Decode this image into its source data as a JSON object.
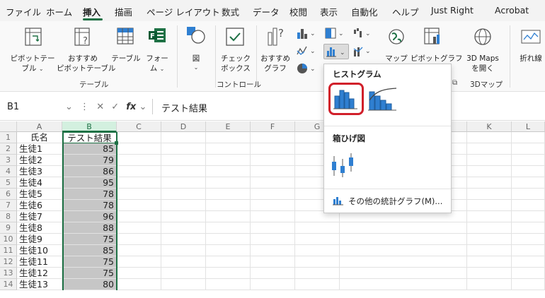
{
  "tabs": [
    {
      "label": "ファイル",
      "active": false
    },
    {
      "label": "ホーム",
      "active": false
    },
    {
      "label": "挿入",
      "active": true
    },
    {
      "label": "描画",
      "active": false
    },
    {
      "label": "ページ レイアウト",
      "active": false
    },
    {
      "label": "数式",
      "active": false
    },
    {
      "label": "データ",
      "active": false
    },
    {
      "label": "校閲",
      "active": false
    },
    {
      "label": "表示",
      "active": false
    },
    {
      "label": "自動化",
      "active": false
    },
    {
      "label": "ヘルプ",
      "active": false
    },
    {
      "label": "Just Right",
      "active": false
    },
    {
      "label": "Acrobat",
      "active": false
    }
  ],
  "ribbon": {
    "pivot_table_l1": "ピボットテー",
    "pivot_table_l2": "ブル",
    "recommended_pivot_l1": "おすすめ",
    "recommended_pivot_l2": "ピボットテーブル",
    "table": "テーブル",
    "form_l1": "フォー",
    "form_l2": "ム",
    "shapes": "図",
    "checkbox_l1": "チェック",
    "checkbox_l2": "ボックス",
    "recommended_charts_l1": "おすすめ",
    "recommended_charts_l2": "グラフ",
    "map": "マップ",
    "pivot_chart": "ピボットグラフ",
    "maps3d_l1": "3D Maps",
    "maps3d_l2": "を開く",
    "line_sparkline": "折れ線",
    "group_table": "テーブル",
    "group_controls": "コントロール",
    "group_3dmap": "3Dマップ"
  },
  "formula_bar": {
    "name_box": "B1",
    "fx": "fx",
    "content": "テスト結果"
  },
  "grid": {
    "columns": [
      "A",
      "B",
      "C",
      "D",
      "E",
      "F",
      "G",
      "K",
      "L"
    ],
    "selected_column": "B",
    "rows": [
      {
        "n": "1",
        "a": "氏名",
        "b": "テスト結果"
      },
      {
        "n": "2",
        "a": "生徒1",
        "b": "85"
      },
      {
        "n": "3",
        "a": "生徒2",
        "b": "79"
      },
      {
        "n": "4",
        "a": "生徒3",
        "b": "86"
      },
      {
        "n": "5",
        "a": "生徒4",
        "b": "95"
      },
      {
        "n": "6",
        "a": "生徒5",
        "b": "78"
      },
      {
        "n": "7",
        "a": "生徒6",
        "b": "78"
      },
      {
        "n": "8",
        "a": "生徒7",
        "b": "96"
      },
      {
        "n": "9",
        "a": "生徒8",
        "b": "88"
      },
      {
        "n": "10",
        "a": "生徒9",
        "b": "75"
      },
      {
        "n": "11",
        "a": "生徒10",
        "b": "85"
      },
      {
        "n": "12",
        "a": "生徒11",
        "b": "75"
      },
      {
        "n": "13",
        "a": "生徒12",
        "b": "75"
      },
      {
        "n": "14",
        "a": "生徒13",
        "b": "80"
      }
    ]
  },
  "dropdown": {
    "histogram_heading": "ヒストグラム",
    "boxwhisker_heading": "箱ひげ図",
    "more_charts": "その他の統計グラフ(M)..."
  },
  "colors": {
    "accent": "#1e7145",
    "highlight": "#d11f2a",
    "chart_blue": "#2f7fd1"
  }
}
